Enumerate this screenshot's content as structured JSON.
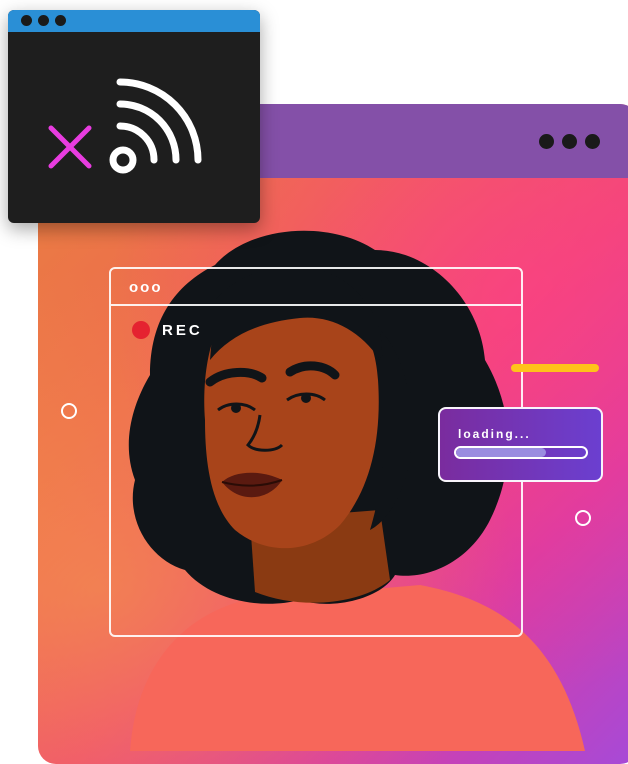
{
  "main_window": {
    "titlebar_color": "#8450a8",
    "window_dots": [
      "dot",
      "dot",
      "dot"
    ]
  },
  "cast_window": {
    "titlebar_color": "#2a8fd6",
    "window_dots": [
      "dot",
      "dot",
      "dot"
    ],
    "icons": [
      "close-icon",
      "cast-signal-icon"
    ],
    "close_icon_color": "#e83ce0"
  },
  "recording_frame": {
    "header_dots": "ooo",
    "rec_label": "REC",
    "rec_color": "#e52230"
  },
  "loading_card": {
    "text": "loading...",
    "progress": 0.69
  },
  "accents": {
    "yellow_line_color": "#ffc21a",
    "ring_icon": "circle-outline-icon"
  },
  "illustration": {
    "subject": "portrait-illustration"
  }
}
